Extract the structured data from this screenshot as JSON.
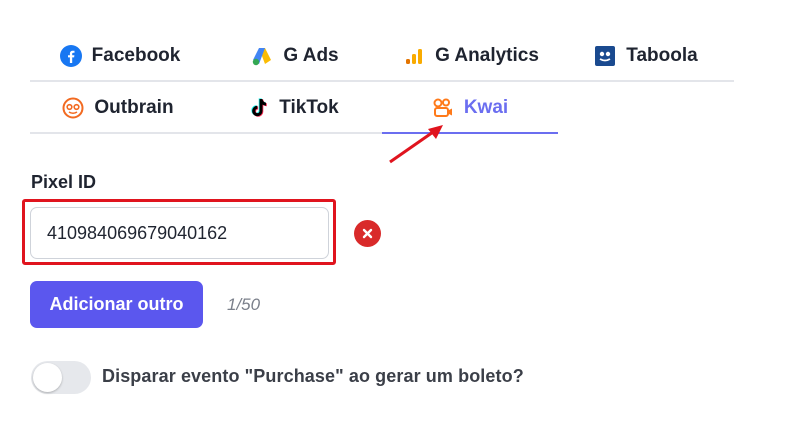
{
  "tabs_row1": [
    {
      "label": "Facebook",
      "icon": "facebook-icon"
    },
    {
      "label": "G Ads",
      "icon": "google-ads-icon"
    },
    {
      "label": "G Analytics",
      "icon": "google-analytics-icon"
    },
    {
      "label": "Taboola",
      "icon": "taboola-icon"
    }
  ],
  "tabs_row2": [
    {
      "label": "Outbrain",
      "icon": "outbrain-icon"
    },
    {
      "label": "TikTok",
      "icon": "tiktok-icon"
    },
    {
      "label": "Kwai",
      "icon": "kwai-icon",
      "active": true
    }
  ],
  "form": {
    "pixel_label": "Pixel ID",
    "pixel_value": "410984069679040162",
    "add_button": "Adicionar outro",
    "counter": "1/50"
  },
  "toggle": {
    "label": "Disparar evento \"Purchase\" ao gerar um boleto?",
    "enabled": false
  },
  "colors": {
    "accent": "#5b57ee",
    "active_tab": "#6b6ef0",
    "highlight": "#e0141e",
    "remove": "#d92a2a"
  }
}
